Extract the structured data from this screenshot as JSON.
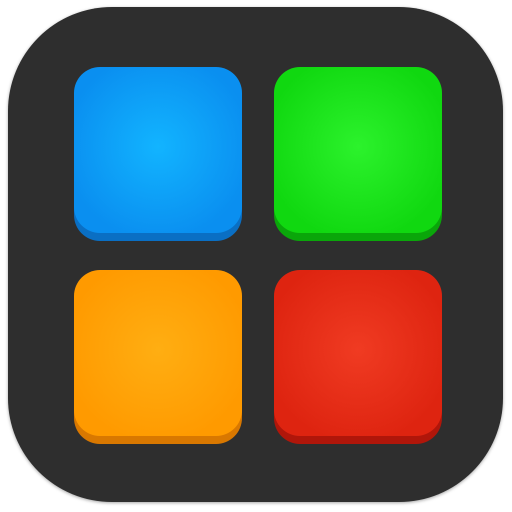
{
  "icon": {
    "base_color": "#2e2e2e",
    "pads": [
      {
        "name": "blue",
        "center": "#12b4ff",
        "outer": "#0a8ff0",
        "edge": "#0a6fc4"
      },
      {
        "name": "green",
        "center": "#2cf22c",
        "outer": "#10d810",
        "edge": "#0aa60a"
      },
      {
        "name": "orange",
        "center": "#ffae12",
        "outer": "#ff9a00",
        "edge": "#d97800"
      },
      {
        "name": "red",
        "center": "#f03b22",
        "outer": "#de2410",
        "edge": "#b0160a"
      }
    ]
  }
}
